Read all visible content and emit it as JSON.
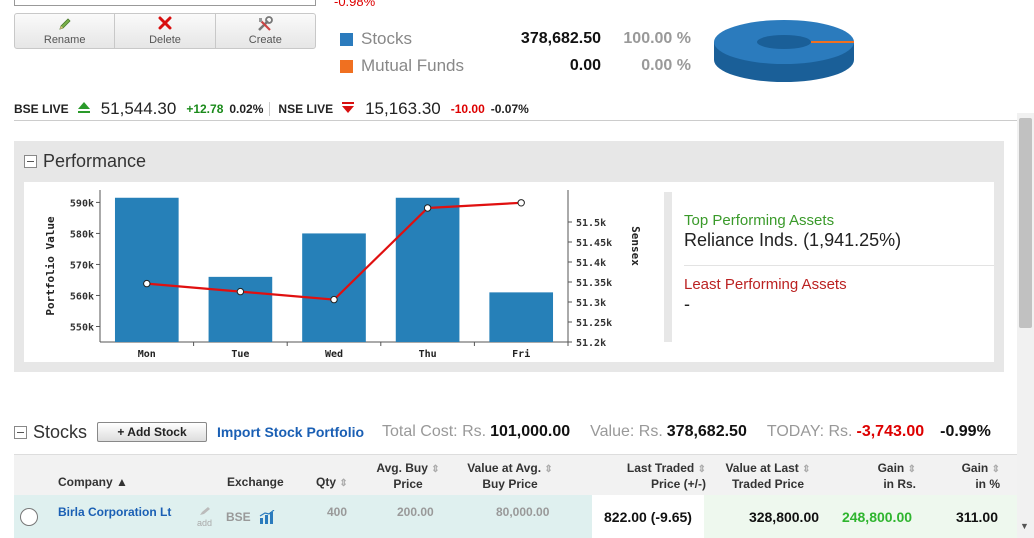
{
  "top": {
    "change_pct": "-0.98%",
    "tools": [
      {
        "label": "Rename",
        "icon": "pencil-icon"
      },
      {
        "label": "Delete",
        "icon": "delete-x-icon"
      },
      {
        "label": "Create",
        "icon": "tools-icon"
      }
    ]
  },
  "allocation": {
    "rows": [
      {
        "name": "Stocks",
        "value": "378,682.50",
        "pct": "100.00 %",
        "color": "#2b7bbd"
      },
      {
        "name": "Mutual Funds",
        "value": "0.00",
        "pct": "0.00 %",
        "color": "#f07020"
      }
    ],
    "pie": [
      {
        "name": "Stocks",
        "value": 100
      },
      {
        "name": "Mutual Funds",
        "value": 0
      }
    ]
  },
  "ticker": {
    "bse_label": "BSE LIVE",
    "bse_value": "51,544.30",
    "bse_change": "+12.78",
    "bse_pct": "0.02%",
    "nse_label": "NSE LIVE",
    "nse_value": "15,163.30",
    "nse_change": "-10.00",
    "nse_pct": "-0.07%"
  },
  "performance": {
    "title": "Performance",
    "top_label": "Top Performing Assets",
    "top_value": "Reliance Inds. (1,941.25%)",
    "least_label": "Least Performing Assets",
    "least_value": "-"
  },
  "chart_data": {
    "type": "bar",
    "categories": [
      "Mon",
      "Tue",
      "Wed",
      "Thu",
      "Fri"
    ],
    "xlabel": "",
    "ylabel": "Portfolio Value",
    "y2label": "Sensex",
    "ylim": [
      545000,
      594000
    ],
    "y2lim": [
      51200,
      51580
    ],
    "yticks": [
      550000,
      560000,
      570000,
      580000,
      590000
    ],
    "yticklabels": [
      "550k",
      "560k",
      "570k",
      "580k",
      "590k"
    ],
    "y2ticks": [
      51200,
      51250,
      51300,
      51350,
      51400,
      51450,
      51500
    ],
    "y2ticklabels": [
      "51.2k",
      "51.25k",
      "51.3k",
      "51.35k",
      "51.4k",
      "51.45k",
      "51.5k"
    ],
    "series": [
      {
        "name": "Portfolio Value",
        "type": "bar",
        "axis": "left",
        "values": [
          591500,
          566000,
          580000,
          591500,
          561000
        ],
        "color": "#2680b8"
      },
      {
        "name": "Sensex",
        "type": "line",
        "axis": "right",
        "values": [
          51346,
          51326,
          51306,
          51535,
          51548
        ],
        "color": "#e01010"
      }
    ]
  },
  "stocks": {
    "title": "Stocks",
    "add_label": "+ Add Stock",
    "import_label": "Import Stock Portfolio",
    "total_cost_label": "Total Cost: Rs.",
    "total_cost": "101,000.00",
    "value_label": "Value: Rs.",
    "value": "378,682.50",
    "today_label": "TODAY: Rs.",
    "today": "-3,743.00",
    "today_pct": "-0.99%",
    "columns": {
      "company": "Company",
      "exchange": "Exchange",
      "qty": "Qty",
      "avg_buy_1": "Avg. Buy",
      "avg_buy_2": "Price",
      "val_avg_1": "Value at Avg.",
      "val_avg_2": "Buy Price",
      "last_1": "Last Traded",
      "last_2": "Price (+/-)",
      "val_last_1": "Value at Last",
      "val_last_2": "Traded Price",
      "gain_rs_1": "Gain",
      "gain_rs_2": "in Rs.",
      "gain_pct_1": "Gain",
      "gain_pct_2": "in %"
    },
    "rows": [
      {
        "company": "Birla Corporation Lt",
        "add": "add",
        "exchange": "BSE",
        "qty": "400",
        "avg_buy": "200.00",
        "val_avg": "80,000.00",
        "last": "822.00 (-9.65)",
        "val_last": "328,800.00",
        "gain_rs": "248,800.00",
        "gain_pct": "311.00"
      }
    ]
  }
}
